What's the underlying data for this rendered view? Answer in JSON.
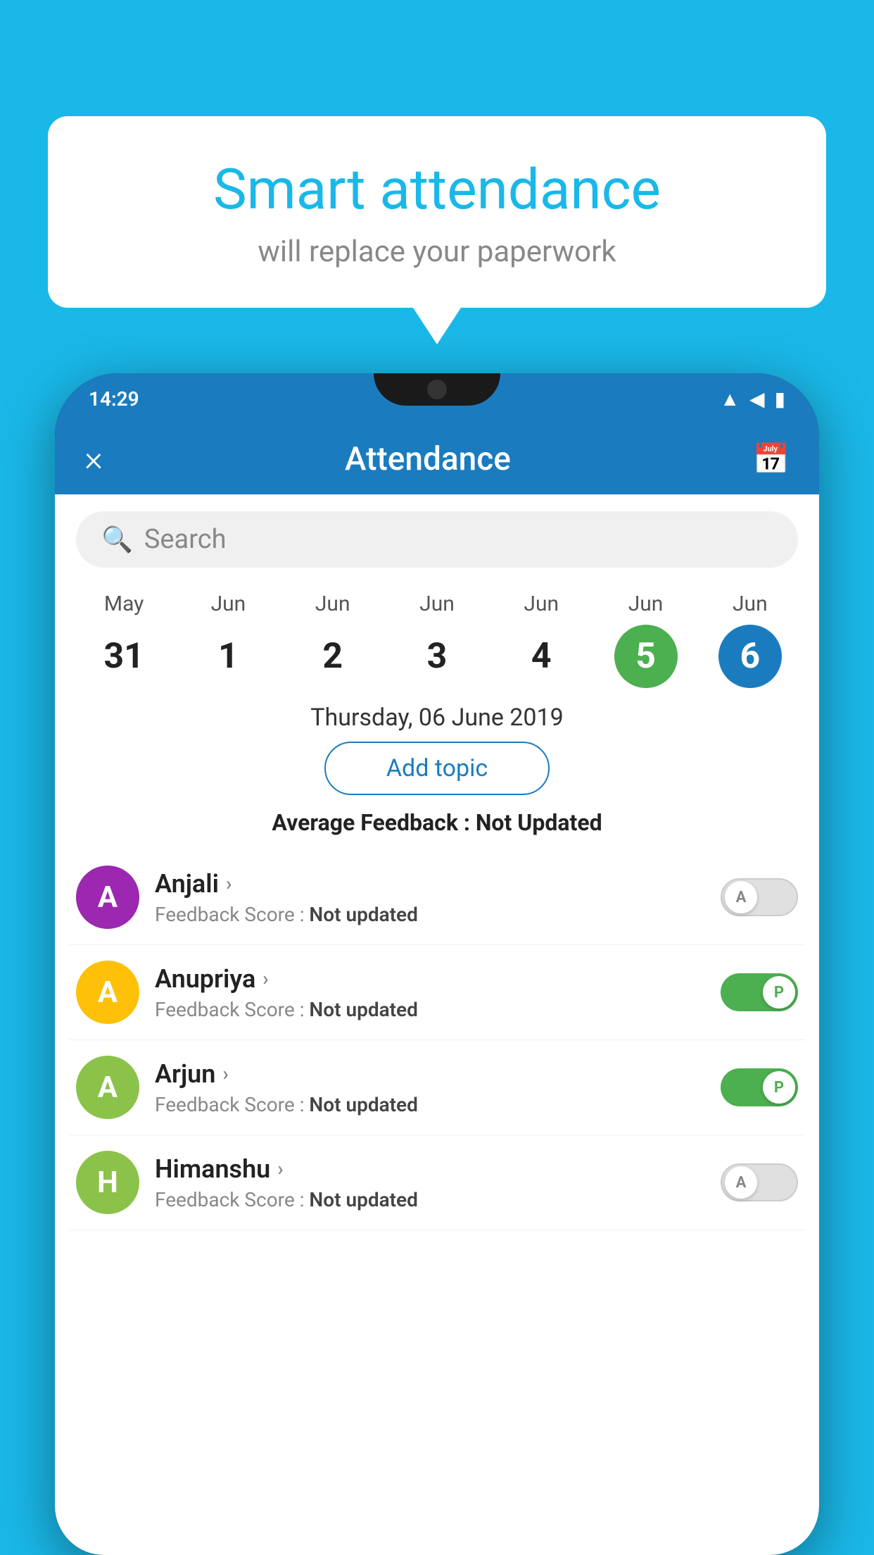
{
  "background_color": "#1ab8e8",
  "speech_bubble": {
    "title": "Smart attendance",
    "subtitle": "will replace your paperwork"
  },
  "status_bar": {
    "time": "14:29",
    "icons": [
      "wifi",
      "signal",
      "battery"
    ]
  },
  "app_header": {
    "title": "Attendance",
    "close_label": "×",
    "calendar_label": "📅"
  },
  "search": {
    "placeholder": "Search"
  },
  "calendar": {
    "days": [
      {
        "month": "May",
        "date": "31",
        "state": "normal"
      },
      {
        "month": "Jun",
        "date": "1",
        "state": "normal"
      },
      {
        "month": "Jun",
        "date": "2",
        "state": "normal"
      },
      {
        "month": "Jun",
        "date": "3",
        "state": "normal"
      },
      {
        "month": "Jun",
        "date": "4",
        "state": "normal"
      },
      {
        "month": "Jun",
        "date": "5",
        "state": "today"
      },
      {
        "month": "Jun",
        "date": "6",
        "state": "selected"
      }
    ]
  },
  "selected_date_label": "Thursday, 06 June 2019",
  "add_topic_label": "Add topic",
  "average_feedback": {
    "label": "Average Feedback : ",
    "value": "Not Updated"
  },
  "students": [
    {
      "name": "Anjali",
      "avatar_letter": "A",
      "avatar_color": "#9c27b0",
      "feedback_label": "Feedback Score : ",
      "feedback_value": "Not updated",
      "toggle": "off",
      "toggle_letter": "A"
    },
    {
      "name": "Anupriya",
      "avatar_letter": "A",
      "avatar_color": "#ffc107",
      "feedback_label": "Feedback Score : ",
      "feedback_value": "Not updated",
      "toggle": "on",
      "toggle_letter": "P"
    },
    {
      "name": "Arjun",
      "avatar_letter": "A",
      "avatar_color": "#8bc34a",
      "feedback_label": "Feedback Score : ",
      "feedback_value": "Not updated",
      "toggle": "on",
      "toggle_letter": "P"
    },
    {
      "name": "Himanshu",
      "avatar_letter": "H",
      "avatar_color": "#8bc34a",
      "feedback_label": "Feedback Score : ",
      "feedback_value": "Not updated",
      "toggle": "off",
      "toggle_letter": "A"
    }
  ]
}
